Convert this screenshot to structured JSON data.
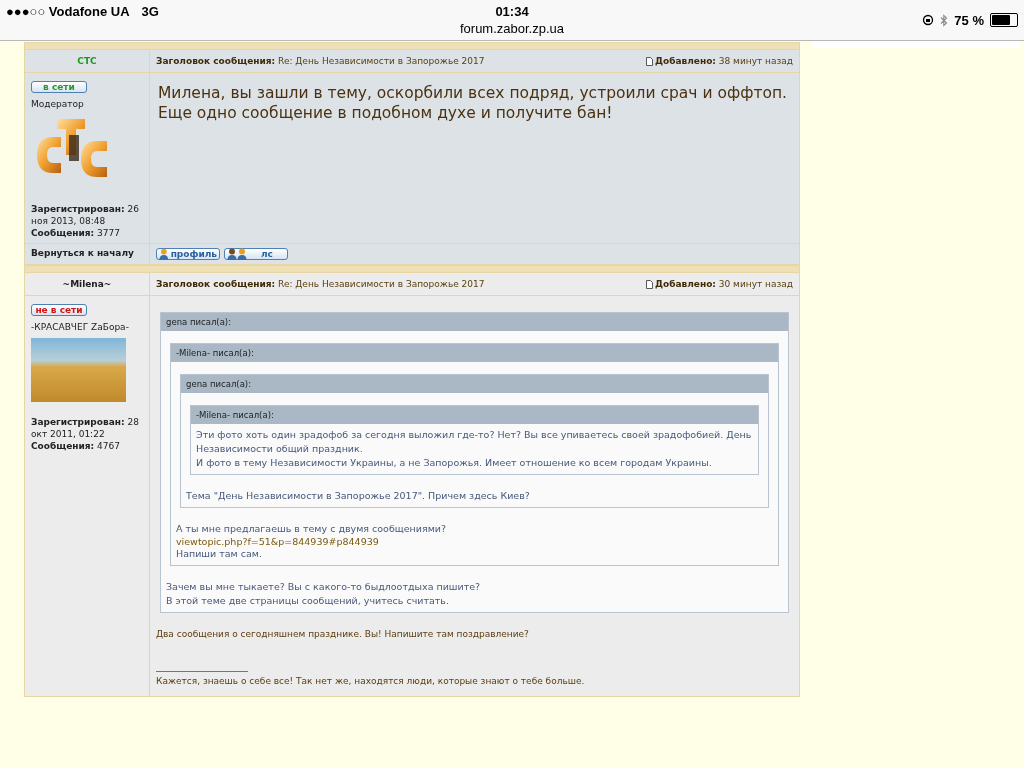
{
  "status_bar": {
    "carrier": "●●●○○ Vodafone UA",
    "network": "3G",
    "time": "01:34",
    "url": "forum.zabor.zp.ua",
    "battery": "75 %"
  },
  "posts": [
    {
      "kind": "moderator",
      "author": "СТС",
      "subject": "**Заголовок сообщения:** Re: День Независимости в Запорожье 2017",
      "added": "**Добавлено:** 38 минут назад",
      "online": true,
      "status_label": "в сети",
      "rank": "Модератор",
      "registered": "**Зарегистрирован:** 26 ноя 2013, 08:48",
      "posts_count": "**Сообщения:** 3777",
      "body": [
        {
          "kind": "big",
          "text": "Милена, вы зашли в тему, оскорбили всех подряд, устроили срач и оффтоп. Еще одно сообщение в подобном духе и получите бан!"
        }
      ],
      "footer": {
        "back_to_top": "Вернуться к началу",
        "buttons": [
          {
            "kind": "profile",
            "label": "профиль"
          },
          {
            "kind": "message",
            "label": "лс"
          }
        ]
      }
    },
    {
      "kind": "member",
      "author": "~Milena~",
      "subject": "**Заголовок сообщения:** Re: День Независимости в Запорожье 2017",
      "added": "**Добавлено:** 30 минут назад",
      "online": false,
      "status_label": "не в сети",
      "rank": "-КРАСАВЧЕГ ZaБора-",
      "registered": "**Зарегистрирован:** 28 окт 2011, 01:22",
      "posts_count": "**Сообщения:** 4767",
      "body": [
        {
          "kind": "quote",
          "author": "gena писал(а):",
          "body": [
            {
              "kind": "quote",
              "author": "-Milena- писал(а):",
              "body": [
                {
                  "kind": "quote",
                  "author": "gena писал(а):",
                  "body": [
                    {
                      "kind": "quote",
                      "author": "-Milena- писал(а):",
                      "body": [
                        {
                          "kind": "text",
                          "text": "Эти фото хоть один зрадофоб за сегодня выложил где-то? Нет? Вы все упиваетесь своей зрадофобией. День Независимости общий праздник."
                        },
                        {
                          "kind": "text",
                          "text": "И фото в тему Независимости Украины, а не Запорожья. Имеет отношение ко всем городам Украины."
                        }
                      ]
                    },
                    {
                      "kind": "text",
                      "text": "Тема \"День Независимости в Запорожье 2017\". Причем здесь Киев?"
                    }
                  ]
                },
                {
                  "kind": "text",
                  "text": "А ты мне предлагаешь в тему с двумя сообщениями?"
                },
                {
                  "kind": "link",
                  "text": "viewtopic.php?f=51&p=844939#p844939"
                },
                {
                  "kind": "text",
                  "text": "Напиши там сам."
                }
              ]
            },
            {
              "kind": "text",
              "text": "Зачем вы мне тыкаете? Вы с какого-то быдлоотдыха пишите?"
            },
            {
              "kind": "text",
              "text": "В этой теме две страницы сообщений, учитесь считать."
            }
          ]
        },
        {
          "kind": "text",
          "text": "Два сообщения о сегодняшнем празднике. Вы! Напишите там поздравление?"
        },
        {
          "kind": "signature",
          "text": "Кажется, знаешь о себе все! Так нет же, находятся люди, которые знают о тебе больше."
        }
      ]
    }
  ]
}
